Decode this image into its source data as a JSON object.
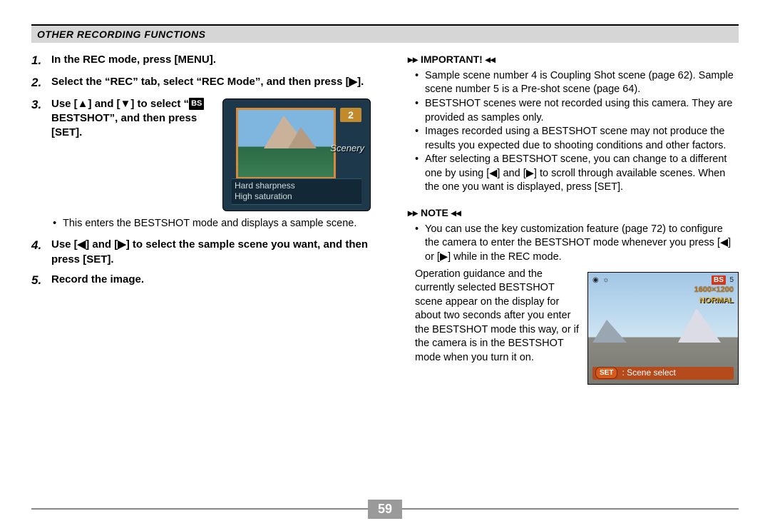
{
  "header": {
    "title": "OTHER RECORDING FUNCTIONS"
  },
  "steps": {
    "s1": {
      "num": "1.",
      "text": "In the REC mode, press [MENU]."
    },
    "s2": {
      "num": "2.",
      "text": "Select the “REC” tab, select “REC Mode”, and then press [▶]."
    },
    "s3": {
      "num": "3.",
      "pre": "Use [▲] and [▼] to select “",
      "bs": "BS",
      "post": " BESTSHOT”, and then press [SET].",
      "sub": "This enters the BESTSHOT mode and displays a sample scene."
    },
    "s4": {
      "num": "4.",
      "text": "Use [◀] and [▶] to select the sample scene you want, and then press [SET]."
    },
    "s5": {
      "num": "5.",
      "text": "Record the image."
    }
  },
  "shot1": {
    "number": "2",
    "label": "Scenery",
    "desc1": "Hard sharpness",
    "desc2": "High saturation"
  },
  "important": {
    "label": "IMPORTANT!",
    "b1": "Sample scene number 4 is Coupling Shot scene (page 62). Sample scene number 5 is a Pre-shot scene (page 64).",
    "b2": "BESTSHOT scenes were not recorded using this camera. They are provided as samples only.",
    "b3": "Images recorded using a BESTSHOT scene may not produce the results you expected due to shooting conditions and other factors.",
    "b4": "After selecting a BESTSHOT scene, you can change to a different one by using [◀] and [▶] to scroll through available scenes. When the one you want is displayed, press [SET]."
  },
  "note": {
    "label": "NOTE",
    "b1": "You can use the key customization feature (page 72) to configure the camera to enter the BESTSHOT mode whenever you press [◀] or [▶] while in the REC mode.",
    "b2": "Operation guidance and the currently selected BESTSHOT scene appear on the display for about two seconds after you enter the BESTSHOT mode this way, or if the camera is in the BESTSHOT mode when you turn it on."
  },
  "shot2": {
    "bs": "BS",
    "num": "5",
    "res": "1600×1200",
    "normal": "NORMAL",
    "set": "SET",
    "bar": ": Scene select"
  },
  "footer": {
    "page": "59"
  }
}
